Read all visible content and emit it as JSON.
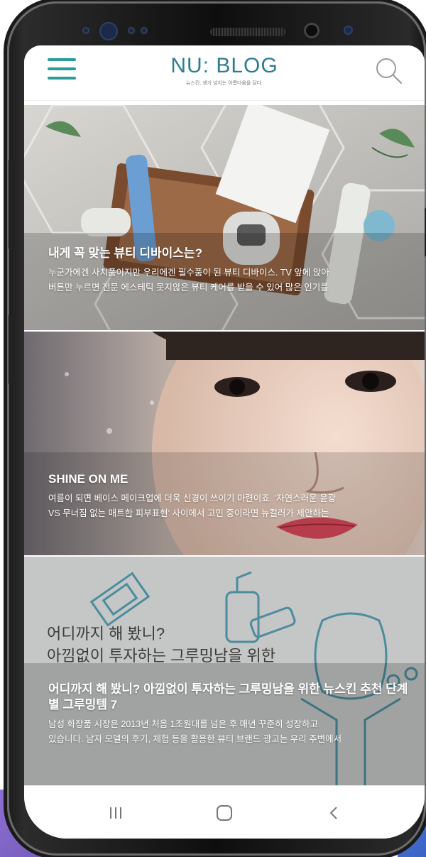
{
  "app": {
    "title": "NU: BLOG",
    "subtitle": "뉴스킨, 생기 넘치는 아름다움을 담다.",
    "accent_color": "#2a9c9a",
    "menu_icon": "hamburger-menu-icon",
    "search_icon": "search-icon"
  },
  "posts": [
    {
      "title": "내게 꼭 맞는 뷰티 디바이스는?",
      "desc_line1": "누군가에겐 사치품이지만 우리에겐 필수품이 된 뷰티 디바이스. TV 앞에 앉아",
      "desc_line2": "버튼만 누르면 전문 에스테틱 못지않은 뷰티 케어를 받을 수 있어 많은 인기를"
    },
    {
      "title": "SHINE ON ME",
      "desc_line1": "여름이 되면 베이스 메이크업에 더욱 신경이 쓰이기 마련이죠. '자연스러운 윤광",
      "desc_line2": "VS 무너짐 없는 매트한 피부표현' 사이에서 고민 중이라면 뉴컬러가 제안하는"
    },
    {
      "illustration_line1": "어디까지 해 봤니?",
      "illustration_line2": "아낌없이 투자하는 그루밍남을 위한",
      "title": "어디까지 해 봤니? 아낌없이 투자하는 그루밍남을 위한 뉴스킨 추천 단계별 그루밍템 7",
      "desc_line1": "남성 화장품 시장은 2013년 처음 1조원대를 넘은 후 매년 꾸준히 성장하고",
      "desc_line2": "있습니다. 남자 모델의 후기, 체험 등을 활용한 뷰티 브랜드 광고는 우리 주변에서"
    }
  ],
  "navbar": {
    "recent_icon": "recent-apps-icon",
    "home_icon": "home-icon",
    "back_icon": "back-icon"
  }
}
